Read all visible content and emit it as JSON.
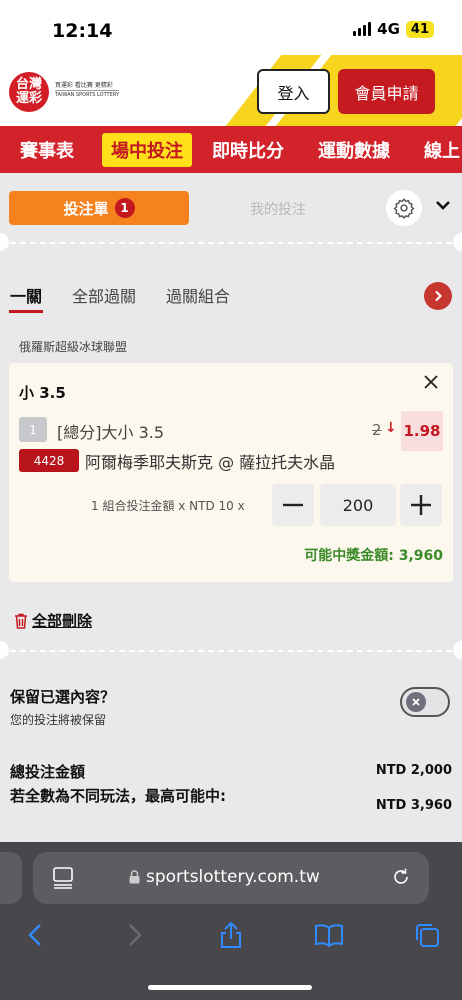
{
  "status_bar": {
    "time": "12:14",
    "network": "4G",
    "battery": "41"
  },
  "header": {
    "logo_text": "台灣\n運彩",
    "logo_tagline": "買運彩 看比賽 更精彩",
    "logo_english": "TAIWAN SPORTS LOTTERY",
    "login_label": "登入",
    "register_label": "會員申請"
  },
  "nav": {
    "items": [
      "賽事表",
      "場中投注",
      "即時比分",
      "運動數據",
      "線上"
    ],
    "active": "場中投注"
  },
  "bet_tabs": {
    "slip_label": "投注單",
    "slip_count": "1",
    "my_bets_label": "我的投注"
  },
  "sub_tabs": {
    "items": [
      "一關",
      "全部過關",
      "過關組合"
    ],
    "active": "一關"
  },
  "league": "俄羅斯超級冰球聯盟",
  "bet": {
    "name": "小 3.5",
    "seq": "1",
    "market": "[總分]大小 3.5",
    "old_odds": "2",
    "new_odds": "1.98",
    "match_code": "4428",
    "match_name": "阿爾梅季耶夫斯克 @ 薩拉托夫水晶",
    "stake_label": "1 組合投注金額 x NTD 10 x",
    "stake_value": "200",
    "payout_label": "可能中獎金額:",
    "payout_value": "3,960"
  },
  "delete_all_label": "全部刪除",
  "keep": {
    "title": "保留已選內容？",
    "subtitle": "您的投注將被保留",
    "enabled": false
  },
  "totals": {
    "total_label": "總投注金額",
    "total_value": "NTD 2,000",
    "max_label": "若全數為不同玩法，最高可能中:",
    "max_value": "NTD 3,960"
  },
  "browser": {
    "url": "sportslottery.com.tw"
  },
  "colors": {
    "brand_red": "#d3232a",
    "accent_yellow": "#ffe01b",
    "slip_orange": "#f5821f",
    "payout_green": "#3b8a27"
  }
}
